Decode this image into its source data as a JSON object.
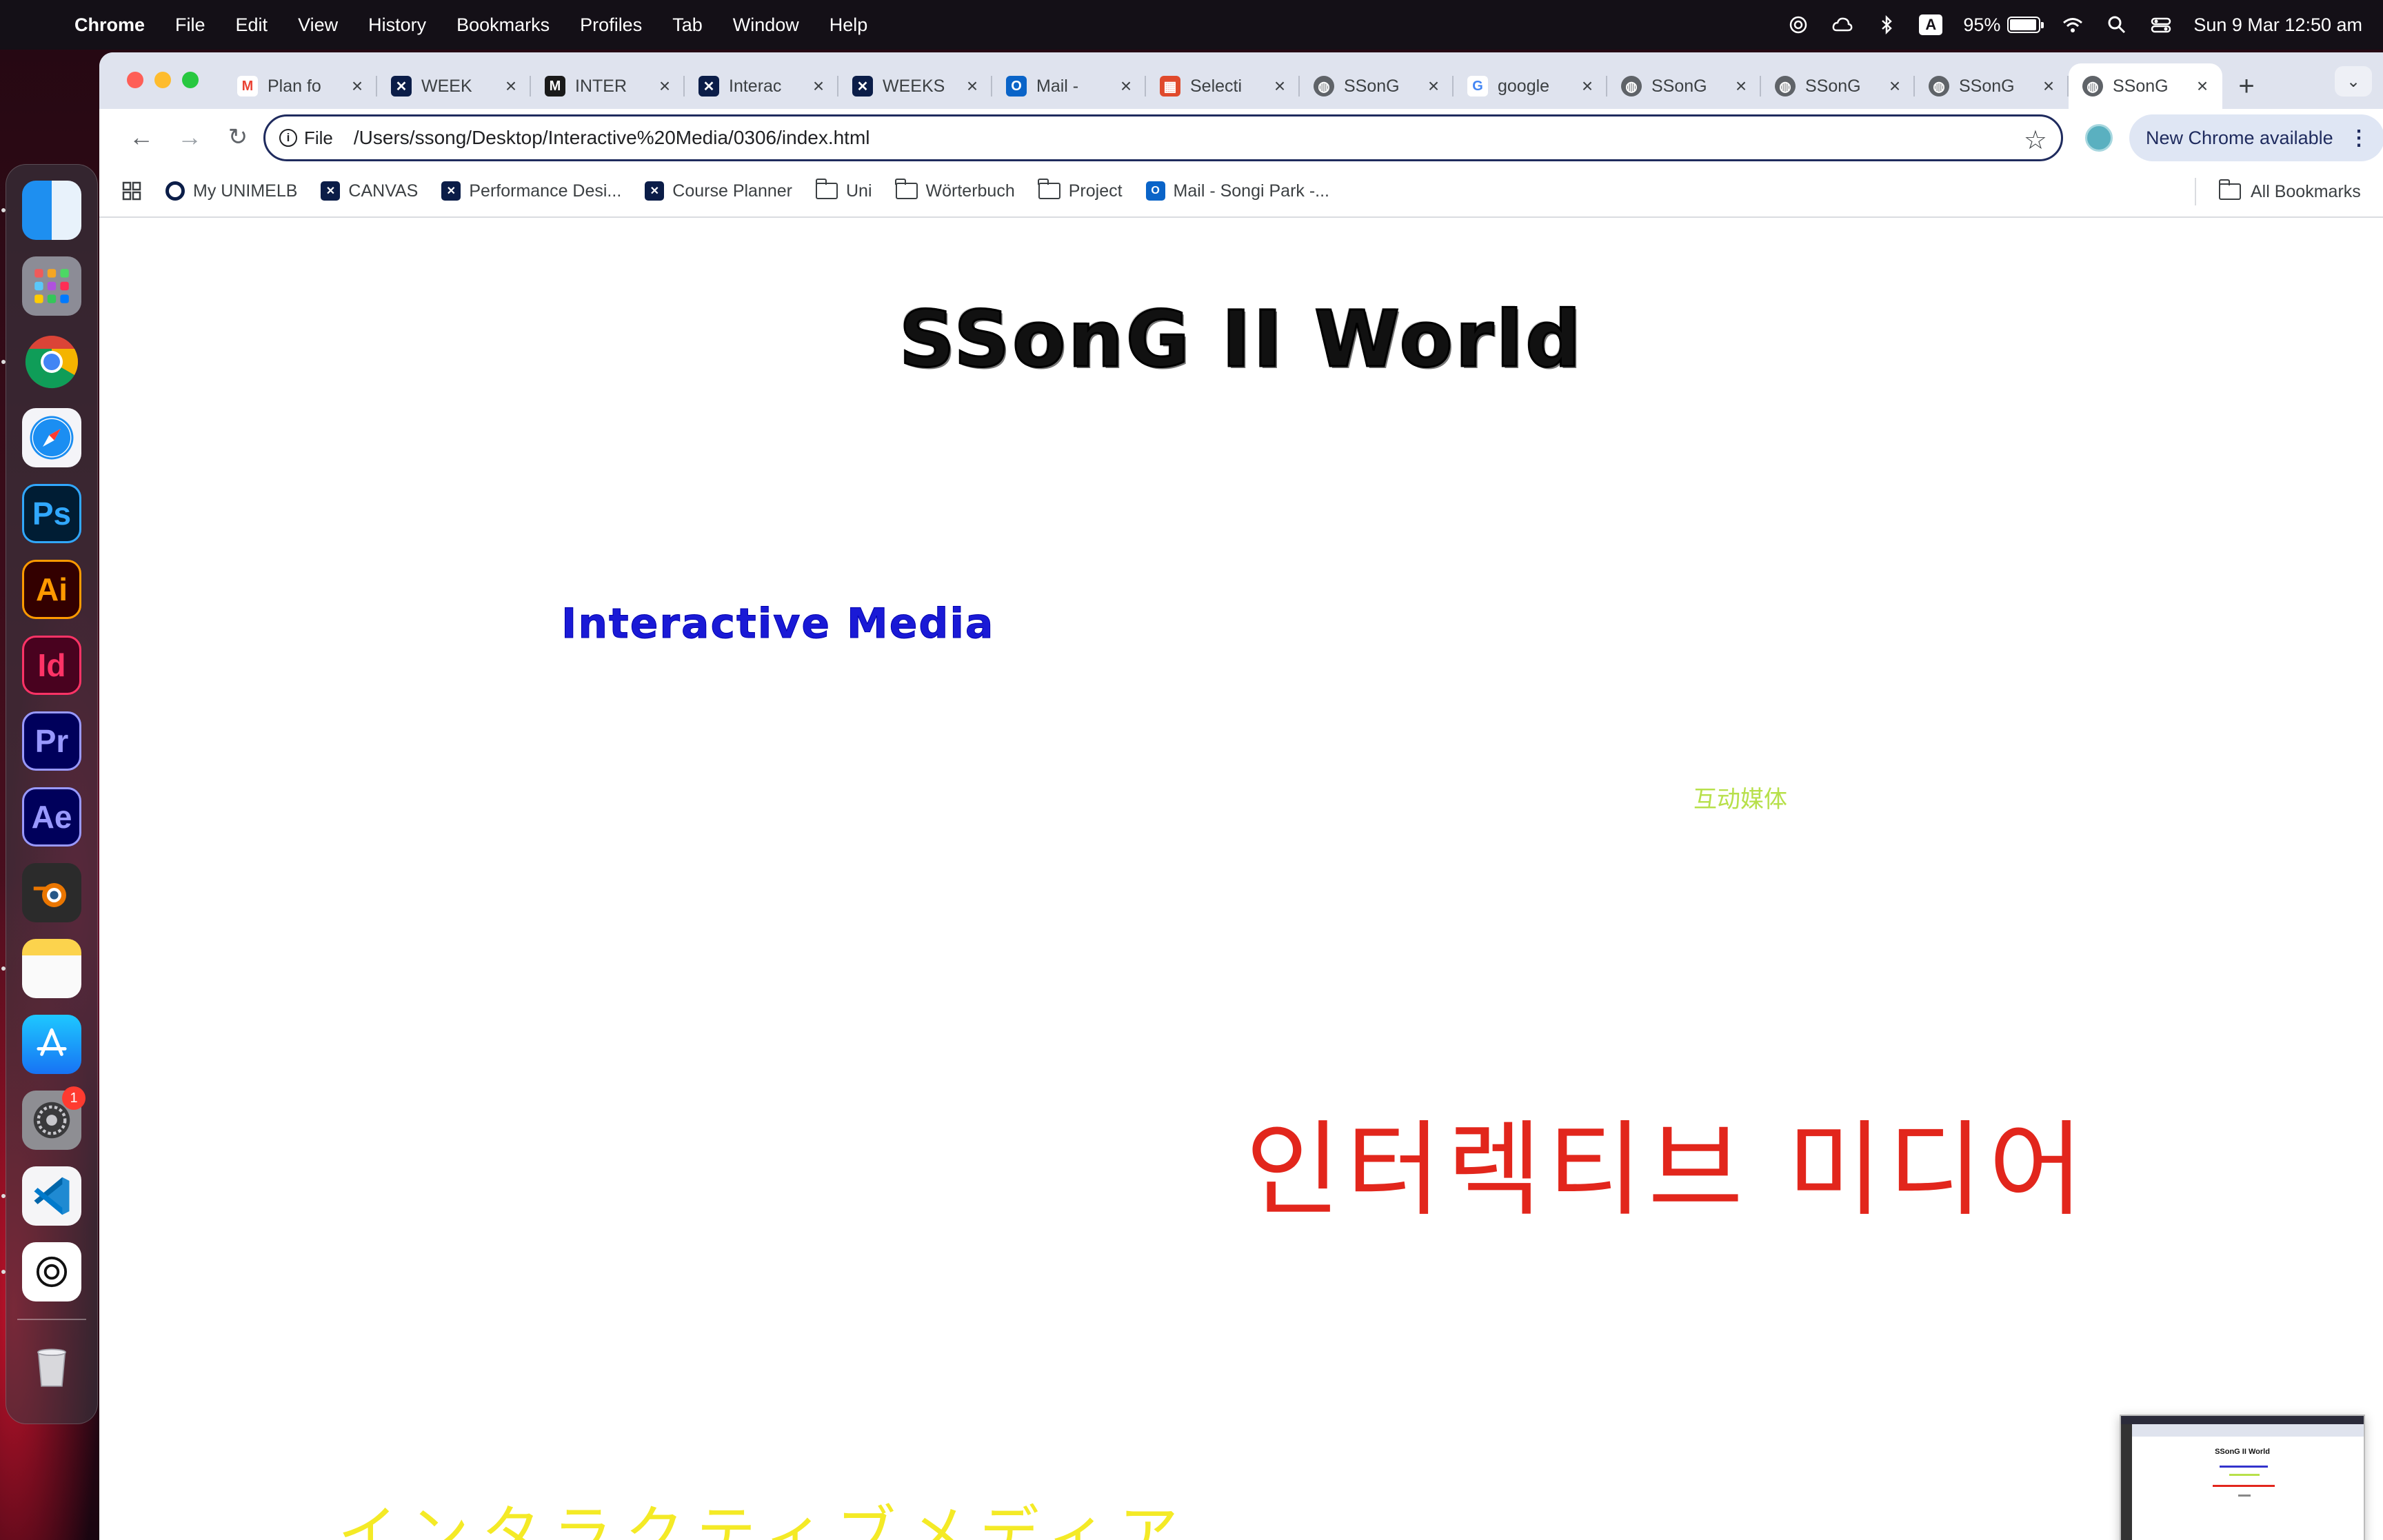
{
  "menubar": {
    "app_name": "Chrome",
    "menus": [
      "File",
      "Edit",
      "View",
      "History",
      "Bookmarks",
      "Profiles",
      "Tab",
      "Window",
      "Help"
    ],
    "keyboard_input": "A",
    "battery_percent": "95%",
    "battery_level": 0.95,
    "datetime": "Sun 9 Mar  12:50 am"
  },
  "dock": {
    "apps": [
      "Finder",
      "Launchpad",
      "Google Chrome",
      "Safari",
      "Photoshop",
      "Illustrator",
      "InDesign",
      "Premiere Pro",
      "After Effects",
      "Blender",
      "Notes",
      "App Store",
      "System Settings",
      "Visual Studio Code",
      "ChatGPT",
      "Trash"
    ],
    "labels": {
      "ps": "Ps",
      "ai": "Ai",
      "id": "Id",
      "pr": "Pr",
      "ae": "Ae"
    },
    "settings_badge": "1"
  },
  "tabs": [
    {
      "title": "Plan fo",
      "icon": "gmail-icon"
    },
    {
      "title": "WEEK",
      "icon": "unimelb-icon"
    },
    {
      "title": "INTER",
      "icon": "m-icon"
    },
    {
      "title": "Interac",
      "icon": "unimelb-icon"
    },
    {
      "title": "WEEKS",
      "icon": "unimelb-icon"
    },
    {
      "title": "Mail - ",
      "icon": "outlook-icon"
    },
    {
      "title": "Selecti",
      "icon": "grid-icon"
    },
    {
      "title": "SSonG",
      "icon": "globe-icon"
    },
    {
      "title": "google",
      "icon": "google-icon"
    },
    {
      "title": "SSonG",
      "icon": "globe-icon"
    },
    {
      "title": "SSonG",
      "icon": "globe-icon"
    },
    {
      "title": "SSonG",
      "icon": "globe-icon"
    },
    {
      "title": "SSonG",
      "icon": "globe-icon",
      "active": true
    }
  ],
  "omnibox": {
    "scheme_label": "File",
    "url": "/Users/ssong/Desktop/Interactive%20Media/0306/index.html"
  },
  "update_chip": "New Chrome available",
  "bookmarks": [
    {
      "label": "My UNIMELB",
      "icon": "unimelb-ring-icon"
    },
    {
      "label": "CANVAS",
      "icon": "unimelb-icon"
    },
    {
      "label": "Performance Desi...",
      "icon": "unimelb-icon"
    },
    {
      "label": "Course Planner",
      "icon": "unimelb-icon"
    },
    {
      "label": "Uni",
      "icon": "folder-icon"
    },
    {
      "label": "Wörterbuch",
      "icon": "folder-icon"
    },
    {
      "label": "Project",
      "icon": "folder-icon"
    },
    {
      "label": "Mail - Songi Park -...",
      "icon": "outlook-icon"
    }
  ],
  "all_bookmarks": "All Bookmarks",
  "page": {
    "title": "SSonG II World",
    "subtitle_en": "Interactive Media",
    "text_zh": "互动媒体",
    "text_ko": "인터렉티브 미디어",
    "text_ja": "インタラクティブメディア",
    "colors": {
      "title": "#111111",
      "en": "#1a1ad6",
      "zh": "#b7e04a",
      "ko": "#e2261c",
      "ja": "#f4ea26"
    }
  }
}
